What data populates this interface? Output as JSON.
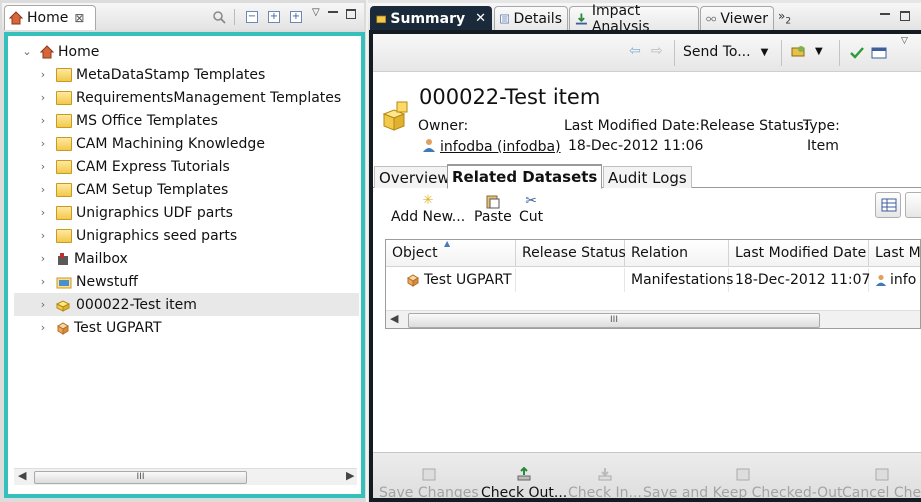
{
  "left": {
    "tab_label": "Home",
    "tree": [
      {
        "label": "Home",
        "icon": "home-icon",
        "expanded": true,
        "indent": 0
      },
      {
        "label": "MetaDataStamp Templates",
        "icon": "folder-icon",
        "indent": 1
      },
      {
        "label": "RequirementsManagement Templates",
        "icon": "folder-icon",
        "indent": 1
      },
      {
        "label": "MS Office Templates",
        "icon": "folder-icon",
        "indent": 1
      },
      {
        "label": "CAM Machining Knowledge",
        "icon": "folder-icon",
        "indent": 1
      },
      {
        "label": "CAM Express Tutorials",
        "icon": "folder-icon",
        "indent": 1
      },
      {
        "label": "CAM Setup Templates",
        "icon": "folder-icon",
        "indent": 1
      },
      {
        "label": "Unigraphics UDF parts",
        "icon": "folder-icon",
        "indent": 1
      },
      {
        "label": "Unigraphics seed parts",
        "icon": "folder-icon",
        "indent": 1
      },
      {
        "label": "Mailbox",
        "icon": "mailbox-icon",
        "indent": 1
      },
      {
        "label": "Newstuff",
        "icon": "newstuff-folder-icon",
        "indent": 1
      },
      {
        "label": "000022-Test item",
        "icon": "item-icon",
        "indent": 1,
        "selected": true
      },
      {
        "label": "Test UGPART",
        "icon": "ugpart-icon",
        "indent": 1
      }
    ],
    "scroll_thumb": "III"
  },
  "right": {
    "tabs": [
      {
        "label": "Summary",
        "icon": "summary-icon",
        "active": true
      },
      {
        "label": "Details",
        "icon": "details-icon"
      },
      {
        "label": "Impact Analysis",
        "icon": "impact-icon"
      },
      {
        "label": "Viewer",
        "icon": "viewer-icon"
      }
    ],
    "overflow_count": "2",
    "toolbar": {
      "send_to": "Send To..."
    },
    "header": {
      "title": "000022-Test item",
      "owner_label": "Owner:",
      "owner_value": "infodba (infodba)",
      "modified_label": "Last Modified Date:",
      "modified_value": "18-Dec-2012 11:06",
      "release_label": "Release Status:",
      "type_label": "Type:",
      "type_value": "Item"
    },
    "subtabs": [
      "Overview",
      "Related Datasets",
      "Audit Logs"
    ],
    "ds_toolbar": [
      {
        "label": "Add New...",
        "icon": "add-new-icon"
      },
      {
        "label": "Paste",
        "icon": "paste-icon"
      },
      {
        "label": "Cut",
        "icon": "cut-icon"
      }
    ],
    "table": {
      "columns": [
        "Object",
        "Release Status",
        "Relation",
        "Last Modified Date",
        "Last M"
      ],
      "rows": [
        [
          "Test UGPART",
          "",
          "Manifestations",
          "18-Dec-2012 11:07",
          "info"
        ]
      ],
      "scroll_thumb": "III"
    },
    "bottom_buttons": [
      {
        "label": "Save Changes",
        "enabled": false
      },
      {
        "label": "Check Out...",
        "enabled": true
      },
      {
        "label": "Check In...",
        "enabled": false
      },
      {
        "label": "Save and Keep Checked-Out",
        "enabled": false
      },
      {
        "label": "Cancel Che",
        "enabled": false
      }
    ]
  }
}
